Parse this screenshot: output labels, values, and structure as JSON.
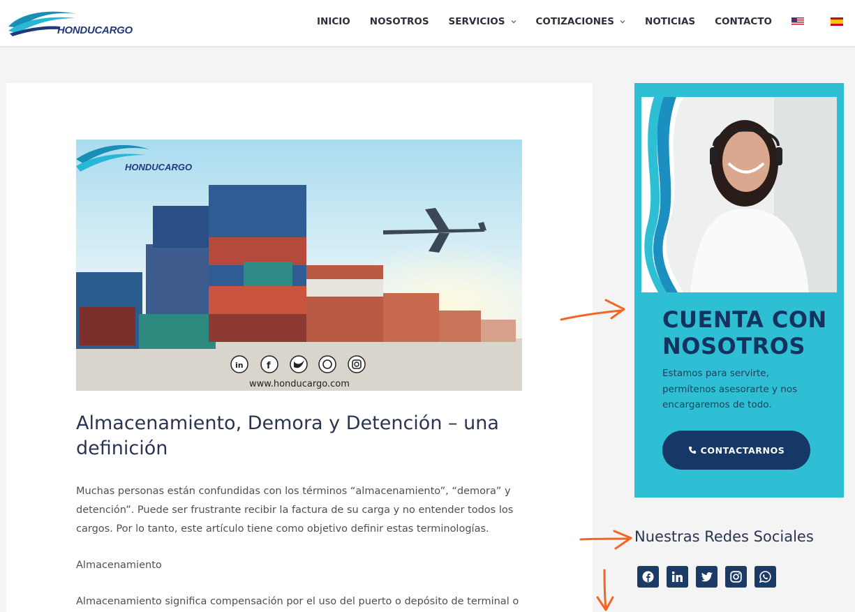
{
  "header": {
    "logo_text": "HONDUCARGO",
    "nav": [
      {
        "label": "INICIO",
        "dropdown": false
      },
      {
        "label": "NOSOTROS",
        "dropdown": false
      },
      {
        "label": "SERVICIOS",
        "dropdown": true
      },
      {
        "label": "COTIZACIONES",
        "dropdown": true
      },
      {
        "label": "NOTICIAS",
        "dropdown": false
      },
      {
        "label": "CONTACTO",
        "dropdown": false
      }
    ],
    "languages": [
      "en-us-flag-icon",
      "es-flag-icon"
    ]
  },
  "article": {
    "hero_logo_text": "HONDUCARGO",
    "hero_url": "www.honducargo.com",
    "hero_social_icons": [
      "linkedin-icon",
      "facebook-icon",
      "twitter-icon",
      "whatsapp-icon",
      "instagram-icon"
    ],
    "title": "Almacenamiento, Demora y Detención – una definición",
    "paragraph1": "Muchas personas están confundidas con los términos “almacenamiento”, “demora” y detención”. Puede ser frustrante recibir la factura de su carga y no entender todos los cargos. Por lo tanto, este artículo tiene como objetivo definir estas terminologías.",
    "subheading": "Almacenamiento",
    "paragraph2": "Almacenamiento significa compensación por el uso del puerto o depósito de terminal o"
  },
  "sidebar": {
    "cta_title": "CUENTA CON NOSOTROS",
    "cta_text": "Estamos para servirte, permítenos asesorarte y nos encargaremos de todo.",
    "cta_button": "CONTACTARNOS",
    "social_title": "Nuestras Redes Sociales",
    "social_icons": [
      "facebook-icon",
      "linkedin-icon",
      "twitter-icon",
      "instagram-icon",
      "whatsapp-icon"
    ]
  },
  "colors": {
    "brand_navy": "#153866",
    "cta_bg": "#2fbfd4",
    "annotation": "#f26522"
  }
}
